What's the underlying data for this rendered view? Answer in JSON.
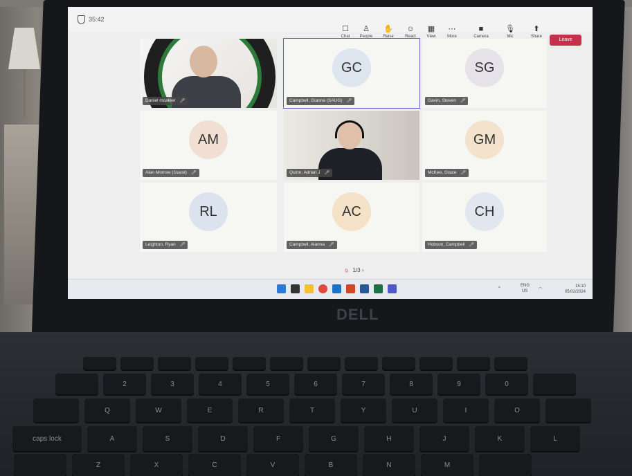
{
  "window": {
    "title": "35:42"
  },
  "controls": [
    {
      "label": "Chat",
      "icon": "chat-icon",
      "glyph": "☐"
    },
    {
      "label": "People",
      "icon": "people-icon",
      "glyph": "♙"
    },
    {
      "label": "Raise",
      "icon": "raise-hand-icon",
      "glyph": "✋"
    },
    {
      "label": "React",
      "icon": "react-icon",
      "glyph": "☺"
    },
    {
      "label": "View",
      "icon": "view-icon",
      "glyph": "▦"
    },
    {
      "label": "More",
      "icon": "more-icon",
      "glyph": "⋯"
    },
    {
      "label": "Camera",
      "icon": "camera-icon",
      "glyph": "■"
    },
    {
      "label": "Mic",
      "icon": "mic-icon",
      "glyph": "🎙"
    },
    {
      "label": "Share",
      "icon": "share-icon",
      "glyph": "⬆"
    }
  ],
  "leave_label": "Leave",
  "participants": [
    {
      "initials": "",
      "name": "Daniel mcateer",
      "has_video": true,
      "video_kind": "logo"
    },
    {
      "initials": "GC",
      "name": "Campbell, Gianna (SAUG)",
      "has_video": false,
      "avatar_color": "#dde6ee"
    },
    {
      "initials": "SG",
      "name": "Gavin, Steven",
      "has_video": false,
      "avatar_color": "#e6e2ea"
    },
    {
      "initials": "AM",
      "name": "Alan Morrow (Guest)",
      "has_video": false,
      "avatar_color": "#f1dfd3"
    },
    {
      "initials": "",
      "name": "Quinn, Adrian J",
      "has_video": true,
      "video_kind": "headset"
    },
    {
      "initials": "GM",
      "name": "McKee, Grace",
      "has_video": false,
      "avatar_color": "#f3e3cc"
    },
    {
      "initials": "RL",
      "name": "Leighton, Ryan",
      "has_video": false,
      "avatar_color": "#dbe3ee"
    },
    {
      "initials": "AC",
      "name": "Campbell, Alanna",
      "has_video": false,
      "avatar_color": "#f4e2c8"
    },
    {
      "initials": "CH",
      "name": "Hobson, Campbell",
      "has_video": false,
      "avatar_color": "#e2e6ee"
    }
  ],
  "pager": {
    "text": "1/3",
    "next": "›"
  },
  "tray": {
    "lang": "ENG",
    "region": "US",
    "time": "15:10",
    "date": "05/02/2024"
  },
  "laptop_brand": "DELL",
  "keyboard": {
    "row1": [
      "",
      "",
      "",
      "",
      "",
      "",
      "",
      "",
      "",
      "",
      "",
      ""
    ],
    "row2": [
      "",
      "2",
      "3",
      "4",
      "5",
      "6",
      "7",
      "8",
      "9",
      "0",
      ""
    ],
    "row3": [
      "",
      "Q",
      "W",
      "E",
      "R",
      "T",
      "Y",
      "U",
      "I",
      "O",
      ""
    ],
    "row4": [
      "caps lock",
      "A",
      "S",
      "D",
      "F",
      "G",
      "H",
      "J",
      "K",
      "L"
    ],
    "row5": [
      "",
      "Z",
      "X",
      "C",
      "V",
      "B",
      "N",
      "M",
      ""
    ]
  }
}
